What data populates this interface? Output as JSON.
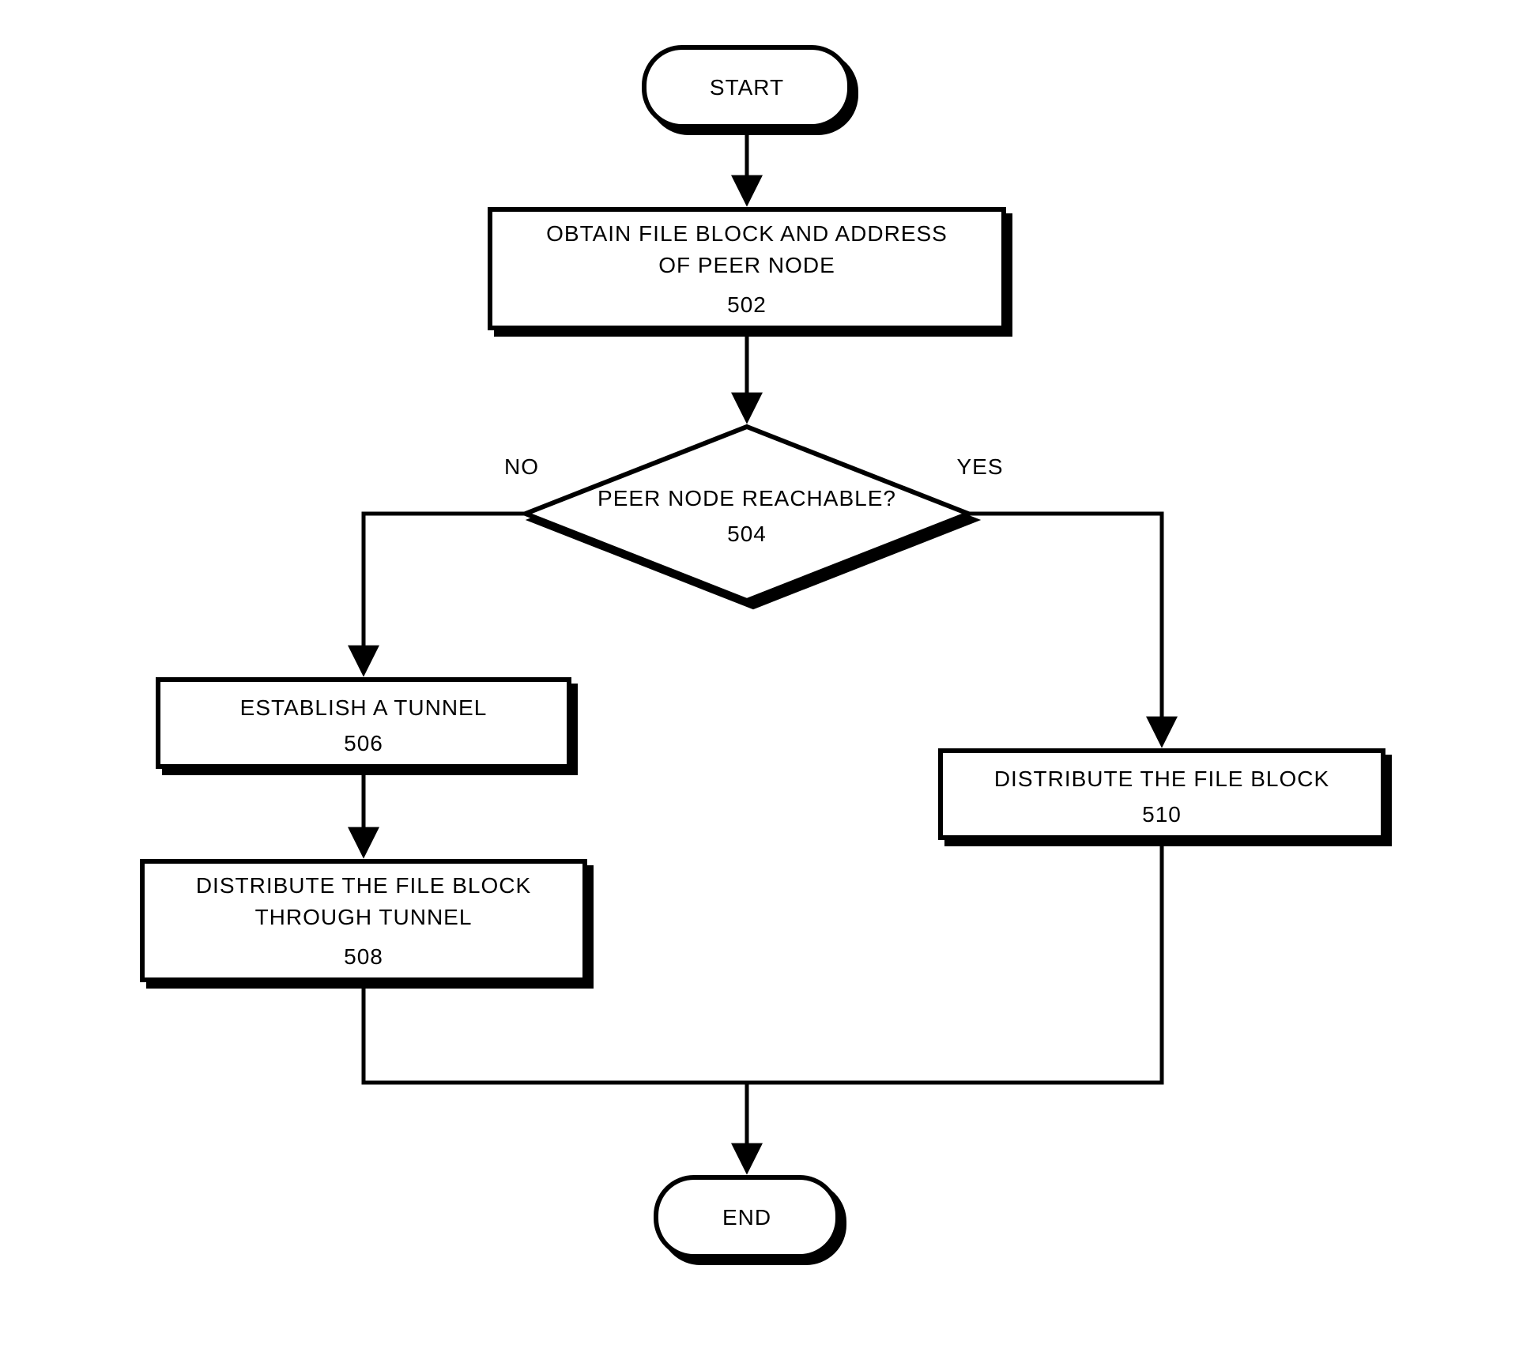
{
  "flowchart": {
    "start": "START",
    "end": "END",
    "step502": {
      "line1": "OBTAIN FILE BLOCK AND ADDRESS",
      "line2": "OF PEER NODE",
      "ref": "502"
    },
    "decision504": {
      "line1": "PEER NODE REACHABLE?",
      "ref": "504",
      "yes": "YES",
      "no": "NO"
    },
    "step506": {
      "line1": "ESTABLISH A TUNNEL",
      "ref": "506"
    },
    "step508": {
      "line1": "DISTRIBUTE THE FILE BLOCK",
      "line2": "THROUGH TUNNEL",
      "ref": "508"
    },
    "step510": {
      "line1": "DISTRIBUTE THE FILE BLOCK",
      "ref": "510"
    }
  }
}
